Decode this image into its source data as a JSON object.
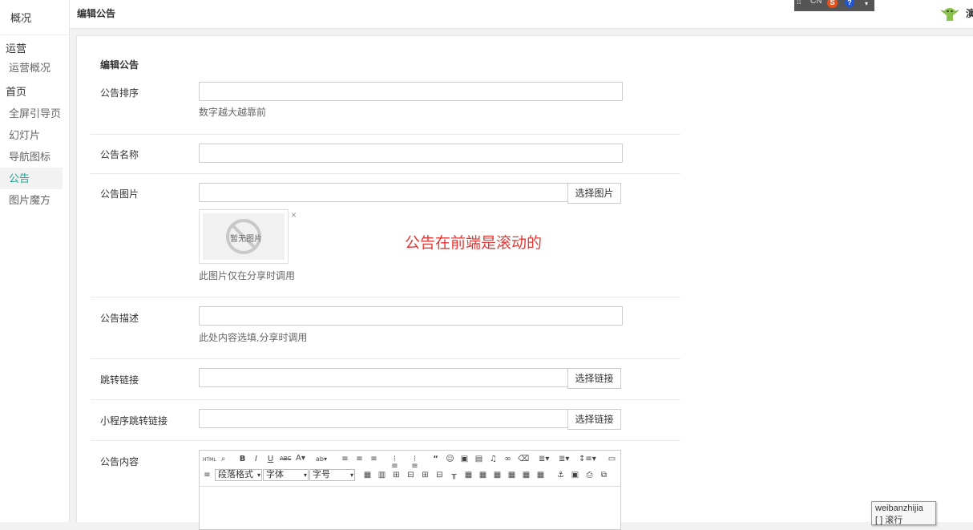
{
  "sidebar": {
    "overview": "概况",
    "groups": [
      {
        "label": "运营",
        "items": [
          "运营概况"
        ]
      },
      {
        "label": "首页",
        "items": [
          "全屏引导页",
          "幻灯片",
          "导航图标",
          "公告",
          "图片魔方"
        ]
      }
    ],
    "active_item": "公告"
  },
  "header": {
    "title": "编辑公告",
    "cut_text": "演"
  },
  "topbar": {
    "lang": "CN",
    "s_icon": "S",
    "help_icon": "?"
  },
  "form": {
    "section_title": "编辑公告",
    "sort": {
      "label": "公告排序",
      "value": "",
      "help": "数字越大越靠前"
    },
    "name": {
      "label": "公告名称",
      "value": ""
    },
    "image": {
      "label": "公告图片",
      "value": "",
      "button": "选择图片",
      "placeholder_text": "暂无图片",
      "help": "此图片仅在分享时调用"
    },
    "desc": {
      "label": "公告描述",
      "value": "",
      "help": "此处内容选填,分享时调用"
    },
    "link": {
      "label": "跳转链接",
      "value": "",
      "button": "选择链接"
    },
    "mini_link": {
      "label": "小程序跳转链接",
      "value": "",
      "button": "选择链接"
    },
    "content": {
      "label": "公告内容"
    }
  },
  "editor": {
    "paragraph": "段落格式",
    "font": "字体",
    "size": "字号"
  },
  "annotation": "公告在前端是滚动的",
  "tooltip": {
    "line1": "weibanzhijia",
    "line2": "[ ] 滚行"
  },
  "colors": {
    "accent": "#1ba394",
    "annotation": "#e53935"
  }
}
